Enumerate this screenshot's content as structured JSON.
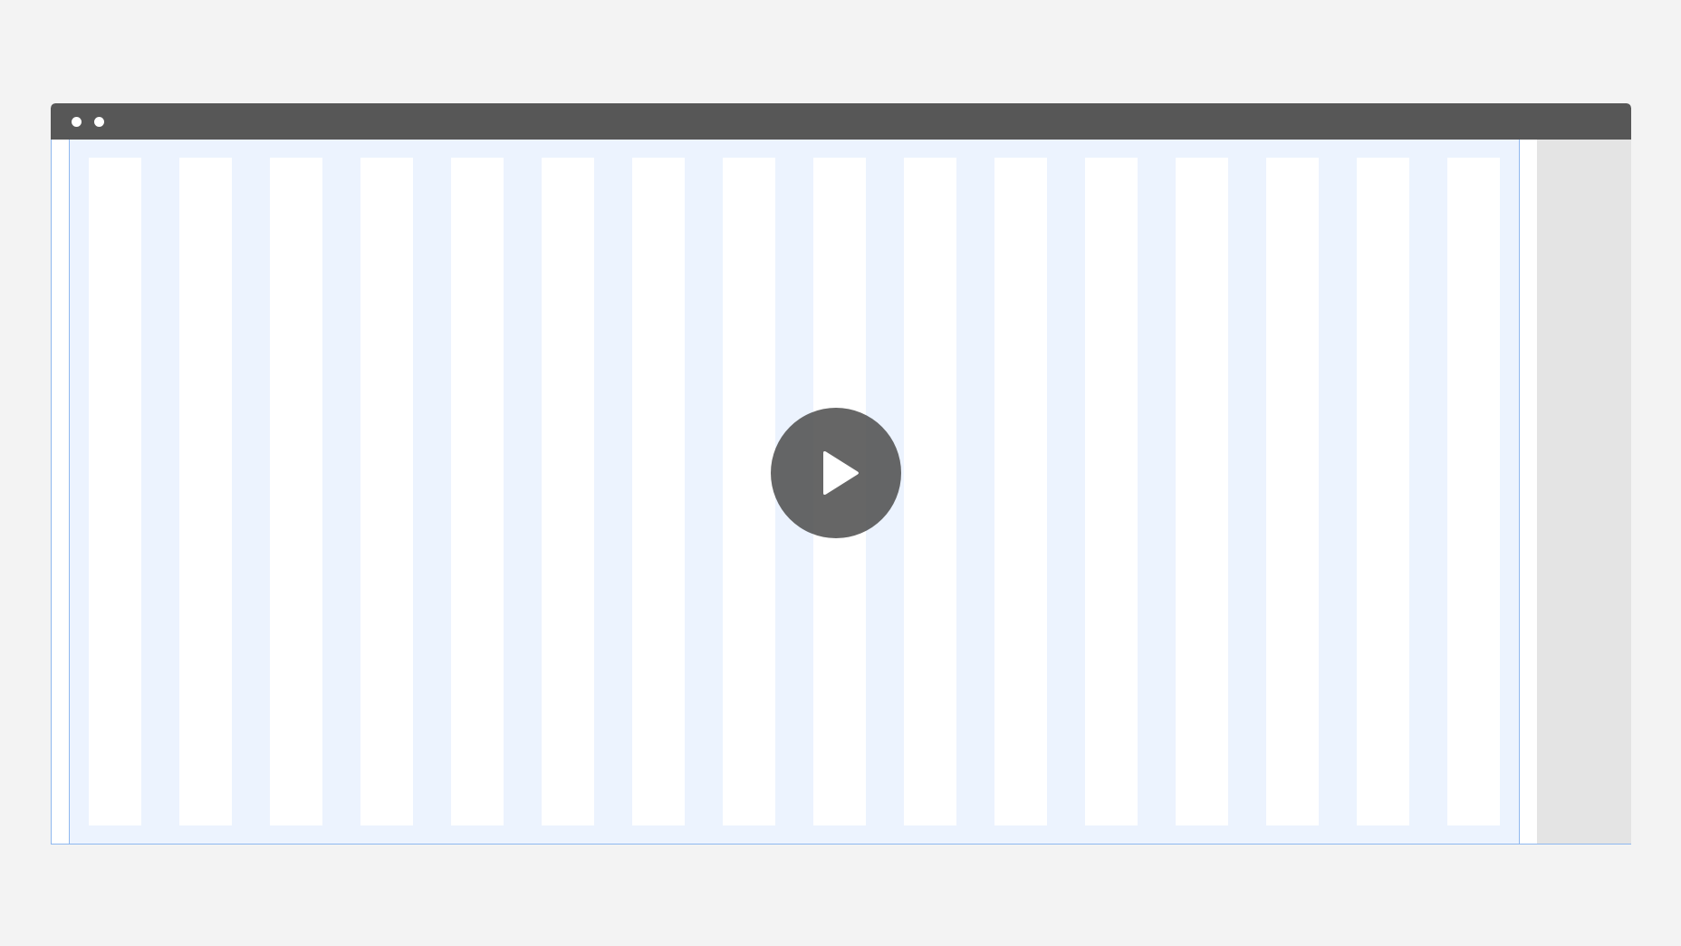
{
  "window": {
    "titlebar_color": "#575757",
    "controls": [
      "window-dot-icon",
      "window-dot-icon"
    ]
  },
  "grid": {
    "column_count": 16,
    "column_color": "#ecf3fe",
    "guide_color": "#8fb8ef",
    "gutter_area_color": "#e4e4e4"
  },
  "player": {
    "overlay_icon": "play-icon",
    "overlay_color": "#555555"
  }
}
